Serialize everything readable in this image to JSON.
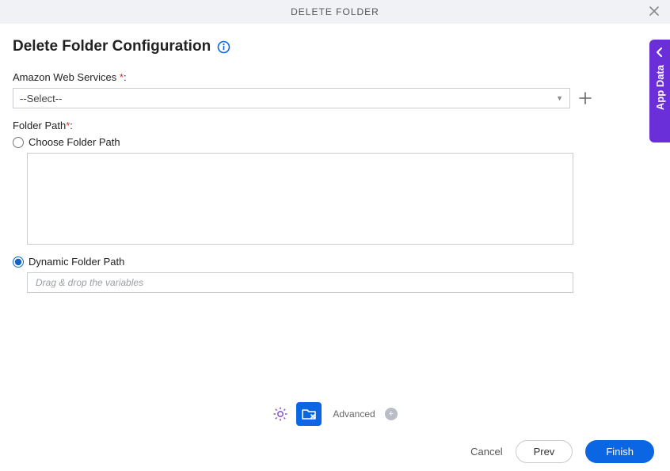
{
  "header": {
    "title": "DELETE FOLDER"
  },
  "page": {
    "title": "Delete Folder Configuration"
  },
  "aws": {
    "label": "Amazon Web Services ",
    "select_value": "--Select--"
  },
  "folder": {
    "label": "Folder Path",
    "choose_label": "Choose Folder Path",
    "dynamic_label": "Dynamic Folder Path",
    "dynamic_placeholder": "Drag & drop the variables"
  },
  "toolbar": {
    "advanced_label": "Advanced"
  },
  "footer": {
    "cancel": "Cancel",
    "prev": "Prev",
    "finish": "Finish"
  },
  "side": {
    "label": "App Data"
  }
}
